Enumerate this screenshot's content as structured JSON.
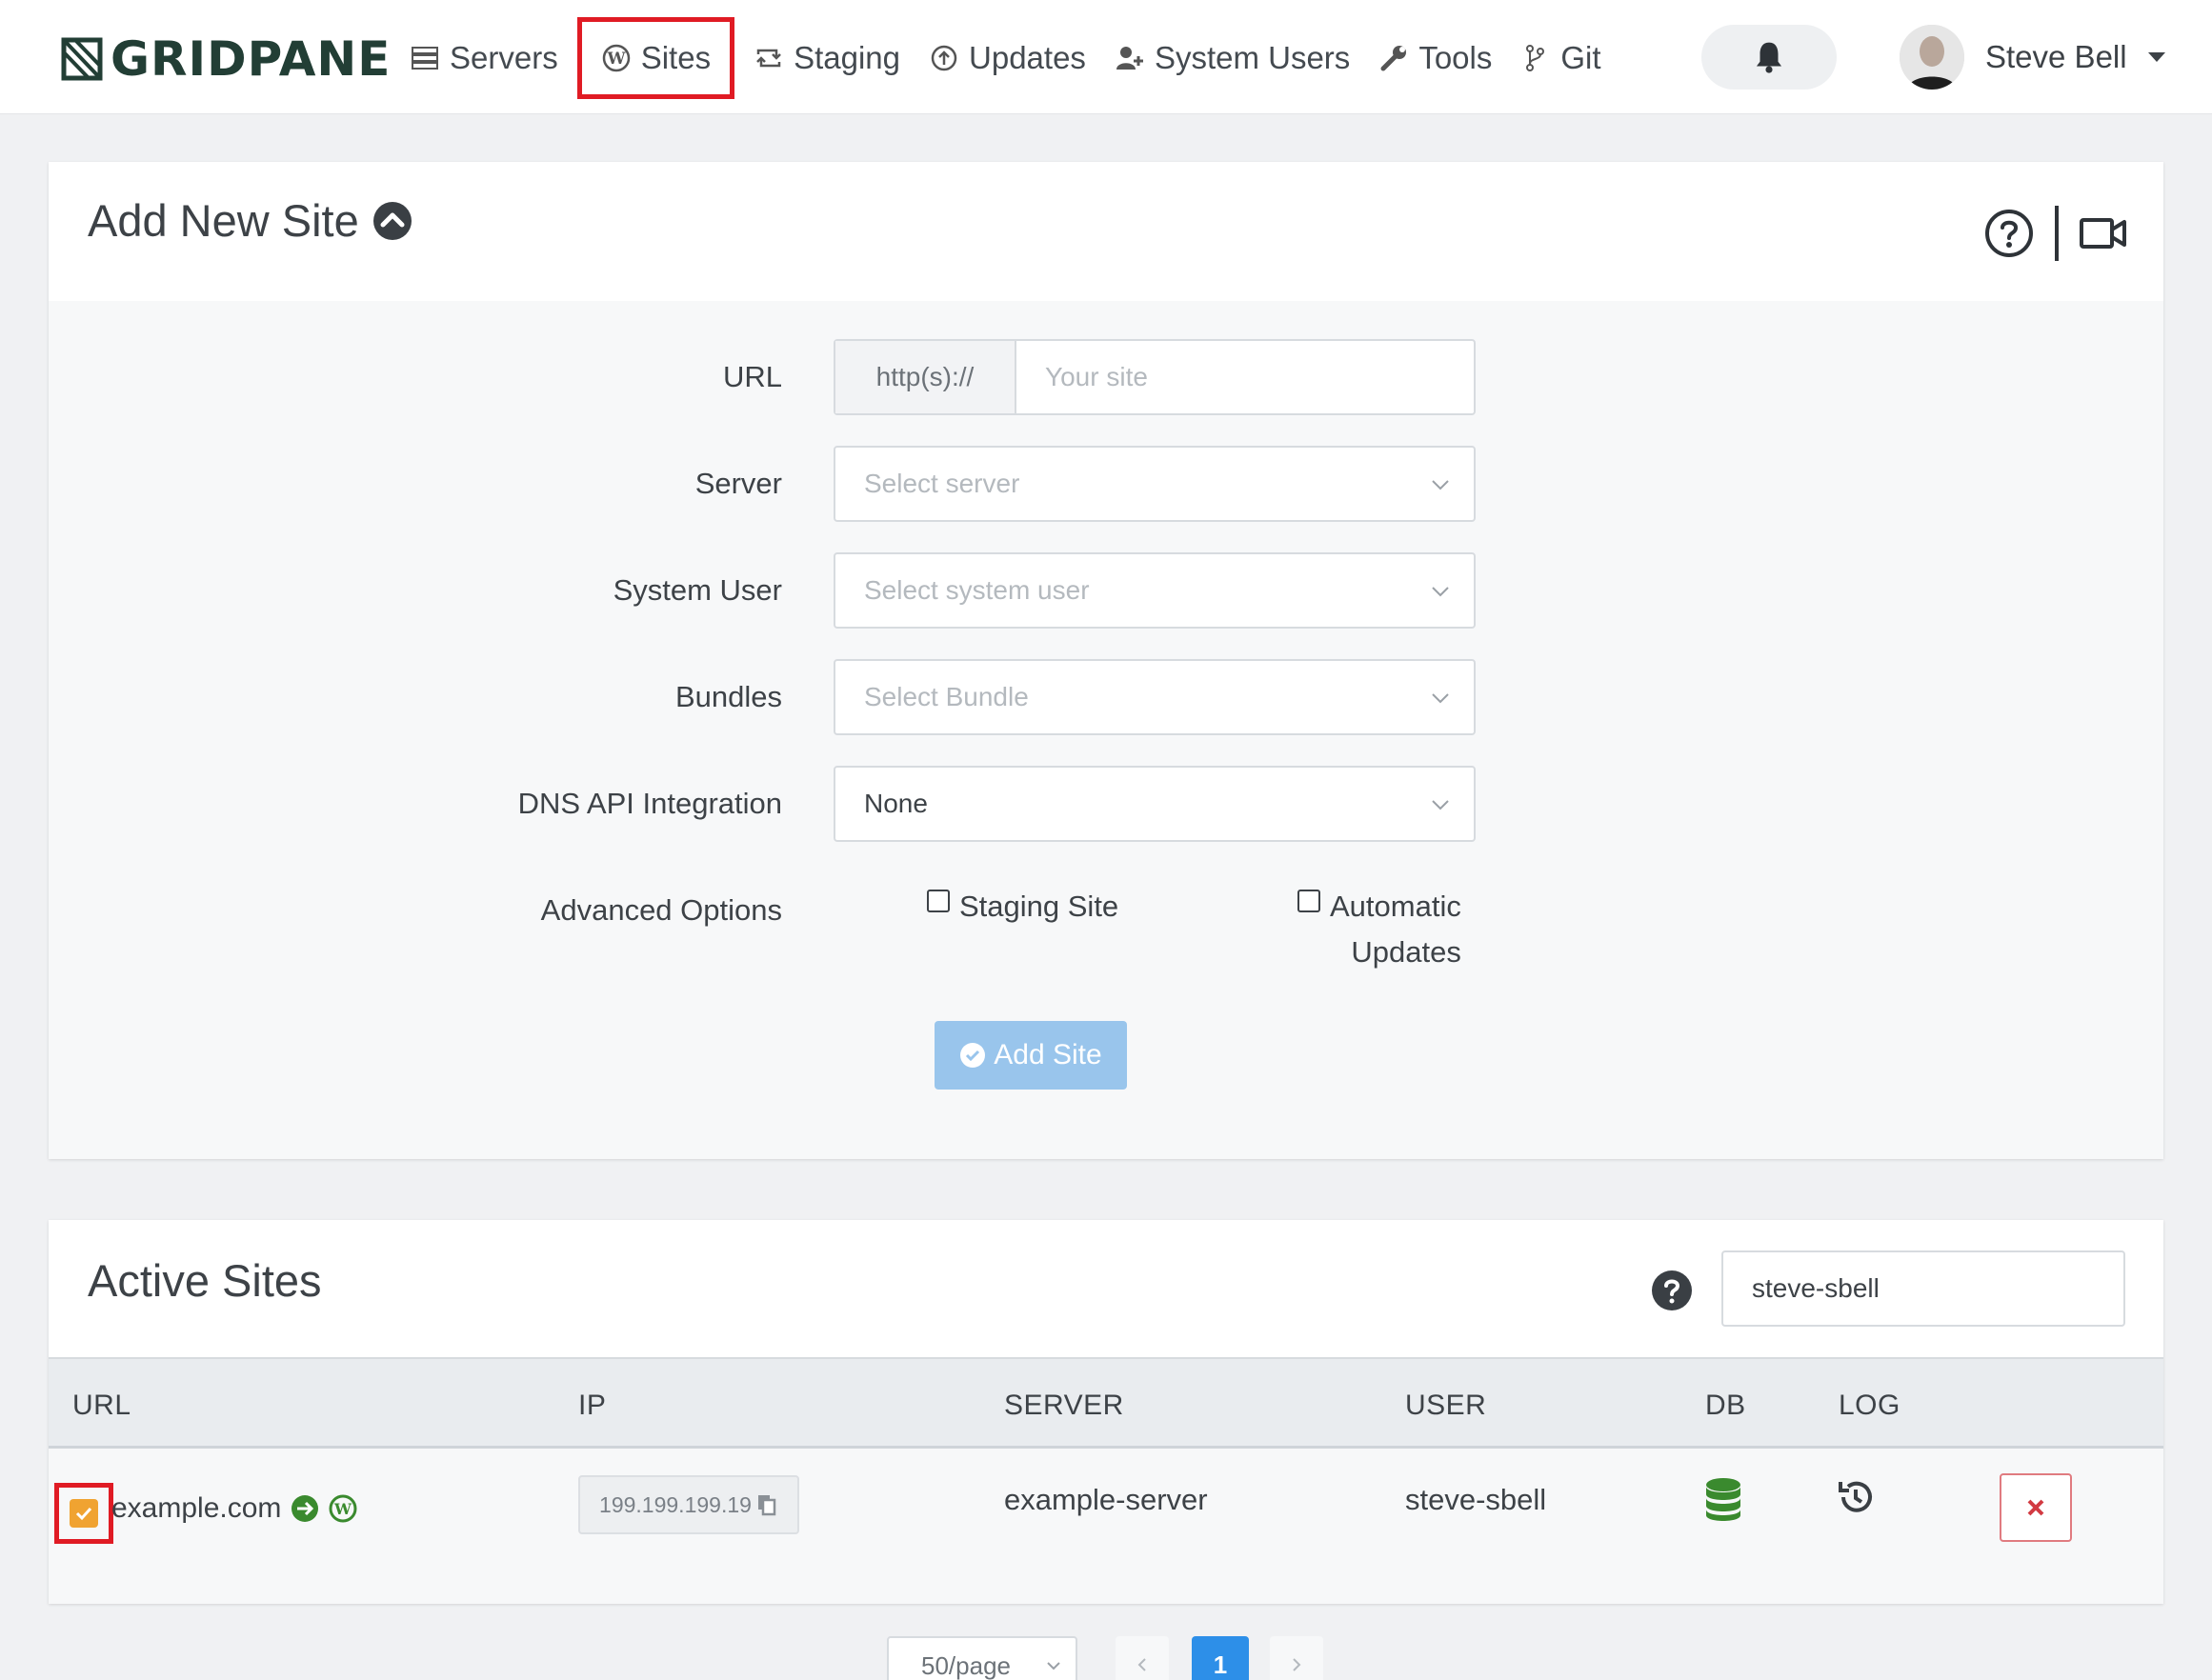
{
  "brand": {
    "name": "GRIDPANE"
  },
  "nav": {
    "items": [
      {
        "key": "servers",
        "label": "Servers",
        "icon": "server-icon"
      },
      {
        "key": "sites",
        "label": "Sites",
        "icon": "wordpress-icon",
        "active": true
      },
      {
        "key": "staging",
        "label": "Staging",
        "icon": "retweet-icon"
      },
      {
        "key": "updates",
        "label": "Updates",
        "icon": "arrow-circle-up-icon"
      },
      {
        "key": "system-users",
        "label": "System Users",
        "icon": "users-plus-icon"
      },
      {
        "key": "tools",
        "label": "Tools",
        "icon": "wrench-icon"
      },
      {
        "key": "git",
        "label": "Git",
        "icon": "git-branch-icon"
      }
    ]
  },
  "user": {
    "name": "Steve Bell"
  },
  "add_site": {
    "title": "Add New Site",
    "fields": {
      "url": {
        "label": "URL",
        "prefix": "http(s)://",
        "placeholder": "Your site"
      },
      "server": {
        "label": "Server",
        "placeholder": "Select server"
      },
      "system_user": {
        "label": "System User",
        "placeholder": "Select system user"
      },
      "bundles": {
        "label": "Bundles",
        "placeholder": "Select Bundle"
      },
      "dns": {
        "label": "DNS API Integration",
        "value": "None"
      }
    },
    "advanced": {
      "label": "Advanced Options",
      "staging_label": "Staging Site",
      "auto_updates_line1": "Automatic",
      "auto_updates_line2": "Updates"
    },
    "submit_label": "Add Site"
  },
  "active_sites": {
    "title": "Active Sites",
    "filter_value": "steve-sbell",
    "columns": [
      "URL",
      "IP",
      "SERVER",
      "USER",
      "DB",
      "LOG"
    ],
    "rows": [
      {
        "url": "example.com",
        "ip": "199.199.199.19",
        "server": "example-server",
        "user": "steve-sbell",
        "checked": true
      }
    ]
  },
  "pagination": {
    "per_page": "50/page",
    "current": "1"
  },
  "colors": {
    "accent_blue": "#2d8fe8",
    "button_disabled": "#99c5ec",
    "highlight_red": "#e01b24",
    "checkbox_orange": "#f0a331",
    "db_green": "#3a8a2e"
  }
}
